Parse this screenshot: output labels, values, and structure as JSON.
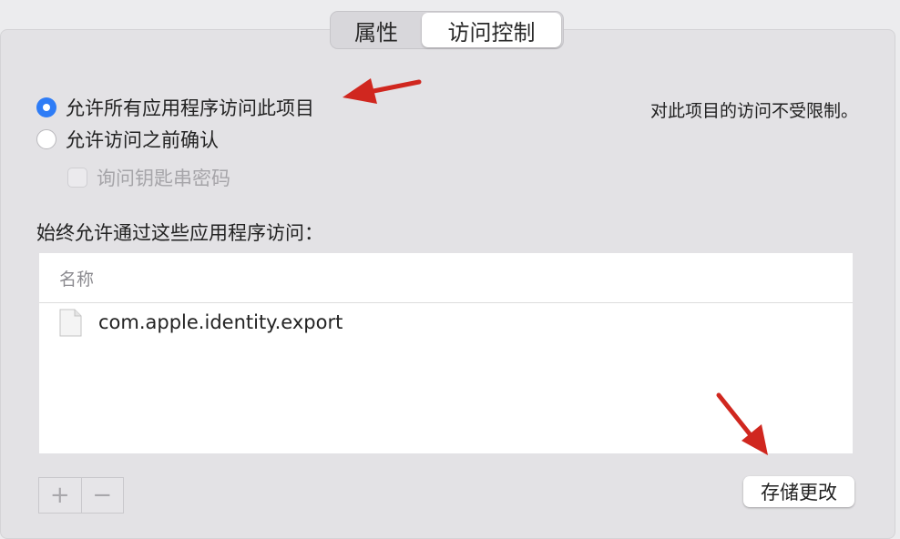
{
  "tabs": {
    "attributes": "属性",
    "access_control": "访问控制"
  },
  "access": {
    "allow_all_label": "允许所有应用程序访问此项目",
    "confirm_label": "允许访问之前确认",
    "ask_keychain_label": "询问钥匙串密码",
    "status_note": "对此项目的访问不受限制。"
  },
  "list": {
    "section_title": "始终允许通过这些应用程序访问：",
    "column_header": "名称",
    "items": [
      {
        "name": "com.apple.identity.export"
      }
    ]
  },
  "controls": {
    "add_symbol": "+",
    "remove_symbol": "−",
    "save_label": "存储更改"
  },
  "colors": {
    "accent": "#2e7cf6",
    "annotation_arrow": "#d0271f"
  },
  "icons": {
    "file": "document-icon",
    "arrow": "annotation-arrow"
  }
}
